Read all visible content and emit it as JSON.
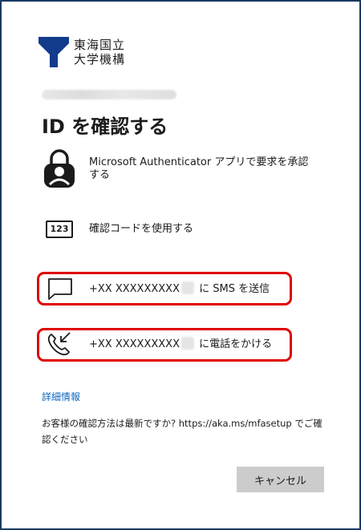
{
  "logo": {
    "line1": "東海国立",
    "line2": "大学機構"
  },
  "title": "ID を確認する",
  "options": {
    "authenticator": {
      "label": "Microsoft Authenticator アプリで要求を承認する",
      "icon": "lock-person-icon"
    },
    "code": {
      "icon_text": "123",
      "label": "確認コードを使用する"
    },
    "sms": {
      "number": "+XX XXXXXXXXX",
      "suffix": "に SMS を送信",
      "icon": "message-icon"
    },
    "call": {
      "number": "+XX XXXXXXXXX",
      "suffix": "に電話をかける",
      "icon": "phone-incoming-icon"
    }
  },
  "more_info": "詳細情報",
  "help": {
    "text": "お客様の確認方法は最新ですか? https://aka.ms/mfasetup でご確認ください"
  },
  "buttons": {
    "cancel": "キャンセル"
  },
  "colors": {
    "frame_border": "#1a3a66",
    "logo_blue": "#123b8c",
    "link": "#0f67bf",
    "highlight": "#e00000",
    "button_bg": "#cccccc"
  }
}
